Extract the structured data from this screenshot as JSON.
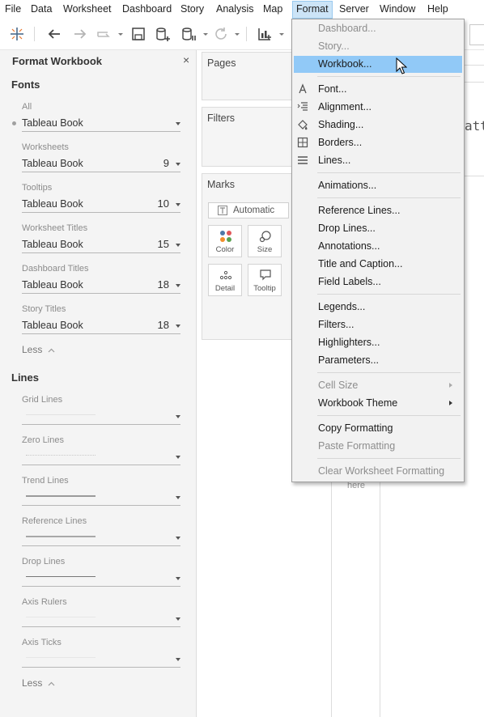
{
  "menubar": {
    "items": [
      {
        "label": "File"
      },
      {
        "label": "Data"
      },
      {
        "label": "Worksheet"
      },
      {
        "label": "Dashboard"
      },
      {
        "label": "Story"
      },
      {
        "label": "Analysis"
      },
      {
        "label": "Map"
      },
      {
        "label": "Format"
      },
      {
        "label": "Server"
      },
      {
        "label": "Window"
      },
      {
        "label": "Help"
      }
    ],
    "active": "Format"
  },
  "toolbar": {
    "icons": [
      "tableau-logo-icon",
      "undo-icon",
      "redo-icon",
      "pause-redo-icon",
      "save-icon",
      "new-data-source-icon",
      "pause-auto-updates-icon",
      "refresh-icon",
      "show-me-icon"
    ]
  },
  "format_panel": {
    "title": "Format Workbook",
    "close_glyph": "×",
    "fonts": {
      "title": "Fonts",
      "fields": [
        {
          "label": "All",
          "font": "Tableau Book",
          "size": ""
        },
        {
          "label": "Worksheets",
          "font": "Tableau Book",
          "size": "9"
        },
        {
          "label": "Tooltips",
          "font": "Tableau Book",
          "size": "10"
        },
        {
          "label": "Worksheet Titles",
          "font": "Tableau Book",
          "size": "15"
        },
        {
          "label": "Dashboard Titles",
          "font": "Tableau Book",
          "size": "18"
        },
        {
          "label": "Story Titles",
          "font": "Tableau Book",
          "size": "18"
        }
      ],
      "less": "Less"
    },
    "lines": {
      "title": "Lines",
      "fields": [
        {
          "label": "Grid Lines"
        },
        {
          "label": "Zero Lines"
        },
        {
          "label": "Trend Lines"
        },
        {
          "label": "Reference Lines"
        },
        {
          "label": "Drop Lines"
        },
        {
          "label": "Axis Rulers"
        },
        {
          "label": "Axis Ticks"
        }
      ],
      "less": "Less"
    }
  },
  "cards": {
    "pages": "Pages",
    "filters": "Filters",
    "marks": "Marks",
    "mark_type": "Automatic",
    "buttons": [
      {
        "label": "Color",
        "icon": "color-icon"
      },
      {
        "label": "Size",
        "icon": "size-icon"
      },
      {
        "label": "Detail",
        "icon": "detail-icon"
      },
      {
        "label": "Tooltip",
        "icon": "tooltip-icon"
      }
    ]
  },
  "canvas": {
    "partial_title": "att",
    "drop_hint_partial": "here"
  },
  "format_menu": {
    "groups": [
      [
        {
          "label": "Dashboard...",
          "disabled": true
        },
        {
          "label": "Story...",
          "disabled": true
        },
        {
          "label": "Workbook...",
          "highlighted": true
        }
      ],
      [
        {
          "label": "Font...",
          "icon": "font-icon"
        },
        {
          "label": "Alignment...",
          "icon": "alignment-icon"
        },
        {
          "label": "Shading...",
          "icon": "shading-icon"
        },
        {
          "label": "Borders...",
          "icon": "borders-icon"
        },
        {
          "label": "Lines...",
          "icon": "lines-icon"
        }
      ],
      [
        {
          "label": "Animations..."
        }
      ],
      [
        {
          "label": "Reference Lines..."
        },
        {
          "label": "Drop Lines..."
        },
        {
          "label": "Annotations..."
        },
        {
          "label": "Title and Caption..."
        },
        {
          "label": "Field Labels..."
        }
      ],
      [
        {
          "label": "Legends..."
        },
        {
          "label": "Filters..."
        },
        {
          "label": "Highlighters..."
        },
        {
          "label": "Parameters..."
        }
      ],
      [
        {
          "label": "Cell Size",
          "disabled": true,
          "submenu": true
        },
        {
          "label": "Workbook Theme",
          "submenu": true
        }
      ],
      [
        {
          "label": "Copy Formatting"
        },
        {
          "label": "Paste Formatting",
          "disabled": true
        }
      ],
      [
        {
          "label": "Clear Worksheet Formatting",
          "disabled": true
        }
      ]
    ]
  },
  "colors": {
    "highlight": "#91c9f7",
    "menu_bg": "#f2f2f2",
    "panel_bg": "#f4f4f4"
  }
}
